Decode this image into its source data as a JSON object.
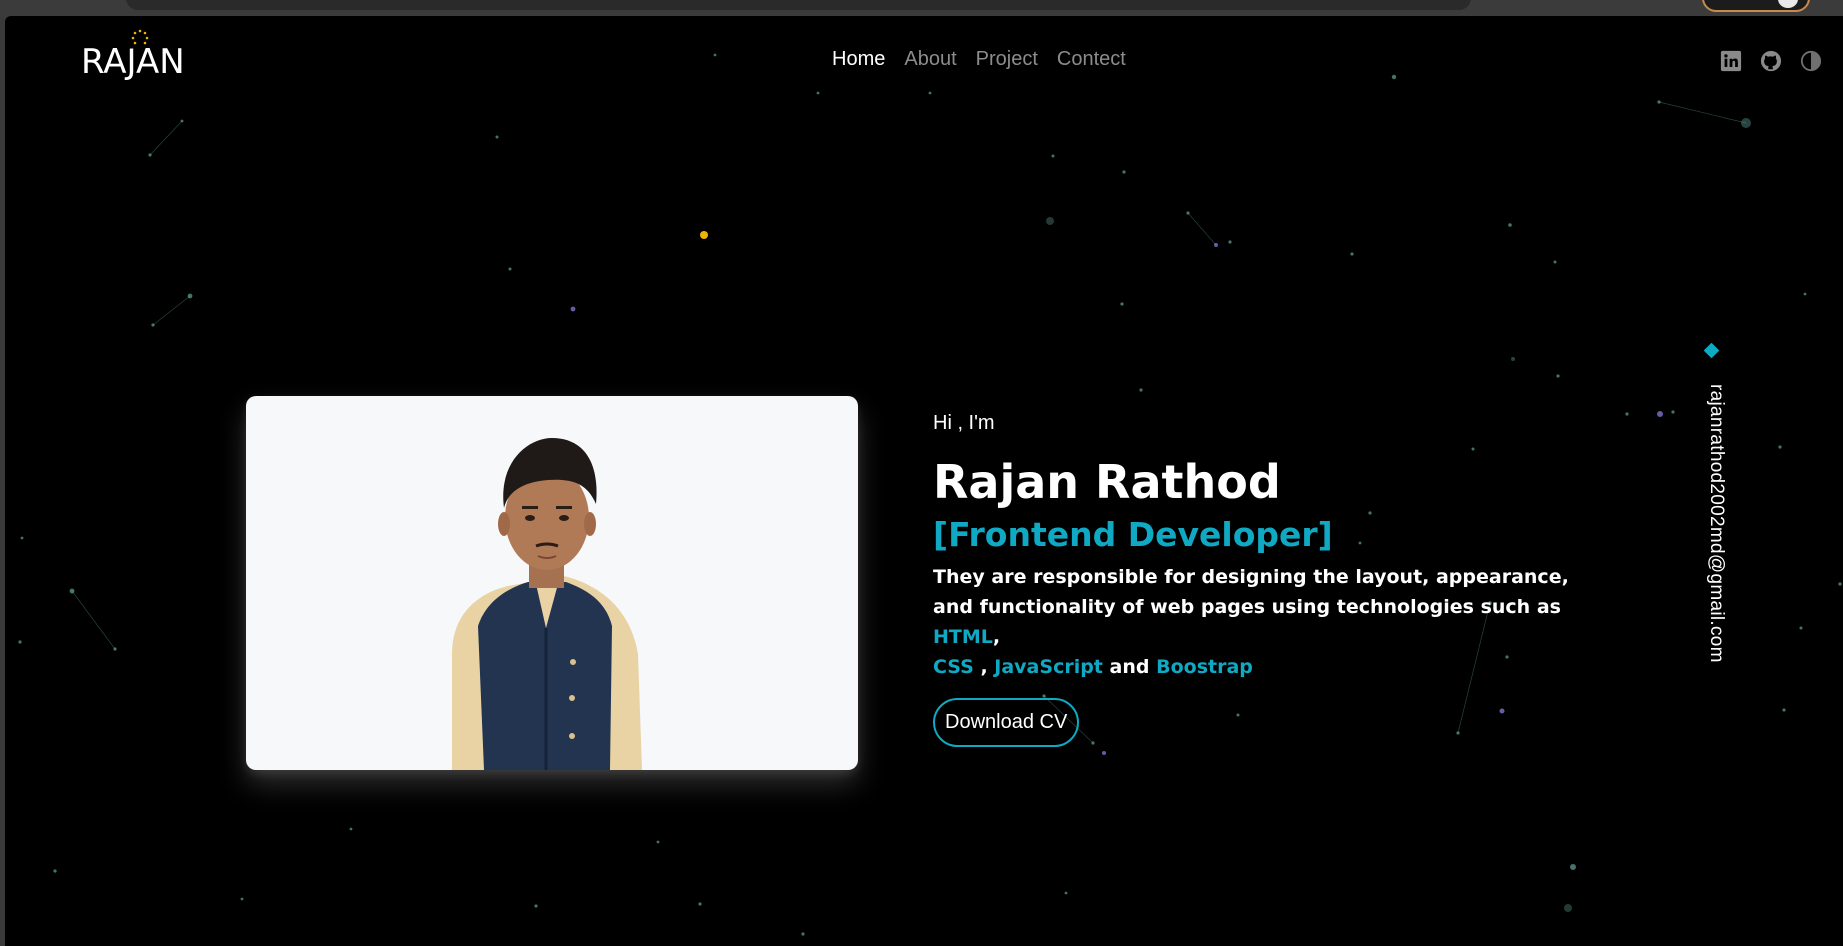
{
  "site": {
    "logo_text": "RAJAN",
    "logo_prefix": "RA",
    "logo_j": "J",
    "logo_suffix": "AN"
  },
  "nav": {
    "items": [
      {
        "label": "Home",
        "active": true
      },
      {
        "label": "About",
        "active": false
      },
      {
        "label": "Project",
        "active": false
      },
      {
        "label": "Contect",
        "active": false
      }
    ]
  },
  "social": {
    "icons": [
      "linkedin-icon",
      "github-icon",
      "theme-toggle-icon"
    ]
  },
  "hero": {
    "greeting": "Hi , I'm",
    "name": "Rajan Rathod",
    "role": "[Frontend Developer]",
    "description_part1": "They are responsible for designing the layout, appearance, and functionality of web pages using technologies such as",
    "tech_html": "HTML",
    "sep1": ",",
    "tech_css": "CSS",
    "sep2": ",",
    "tech_js": "JavaScript",
    "and_word": "and",
    "tech_bootstrap": "Boostrap",
    "cta_label": "Download CV"
  },
  "side": {
    "email": "rajanrathod2002md@gmail.com"
  },
  "colors": {
    "accent": "#10a9c4",
    "background": "#000000",
    "logo_dot": "#f0b400"
  }
}
